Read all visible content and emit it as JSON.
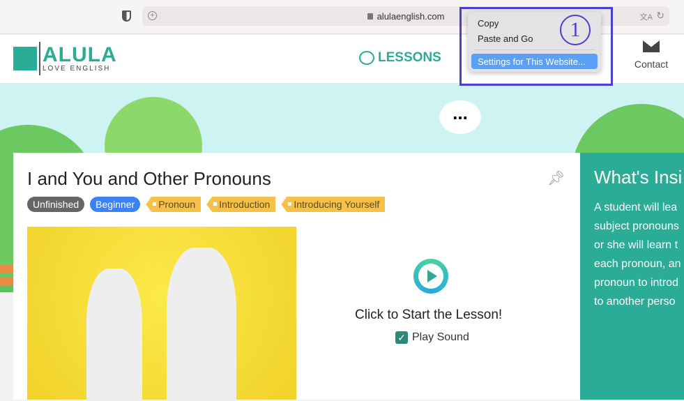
{
  "browser": {
    "url": "alulaenglish.com"
  },
  "context_menu": {
    "items": [
      "Copy",
      "Paste and Go",
      "Settings for This Website..."
    ],
    "selected": "Settings for This Website..."
  },
  "annotation": {
    "number": "1",
    "color": "#4b3fd0"
  },
  "site": {
    "logo_title": "ALULA",
    "logo_subtitle": "LOVE ENGLISH",
    "nav_lessons": "LESSONS",
    "nav_contact": "Contact",
    "brand_color": "#2bac97"
  },
  "hero": {
    "speech": "..."
  },
  "lesson": {
    "title": "I and You and Other Pronouns",
    "status": "Unfinished",
    "level": "Beginner",
    "tags": [
      "Pronoun",
      "Introduction",
      "Introducing Yourself"
    ],
    "start_label": "Click to Start the Lesson!",
    "play_sound_label": "Play Sound",
    "play_sound_checked": true
  },
  "inside": {
    "heading": "What's Insi",
    "lines": [
      "A student will lea",
      "subject pronouns",
      "or she will learn t",
      "each pronoun, an",
      "pronoun to introd",
      "to another perso"
    ]
  }
}
